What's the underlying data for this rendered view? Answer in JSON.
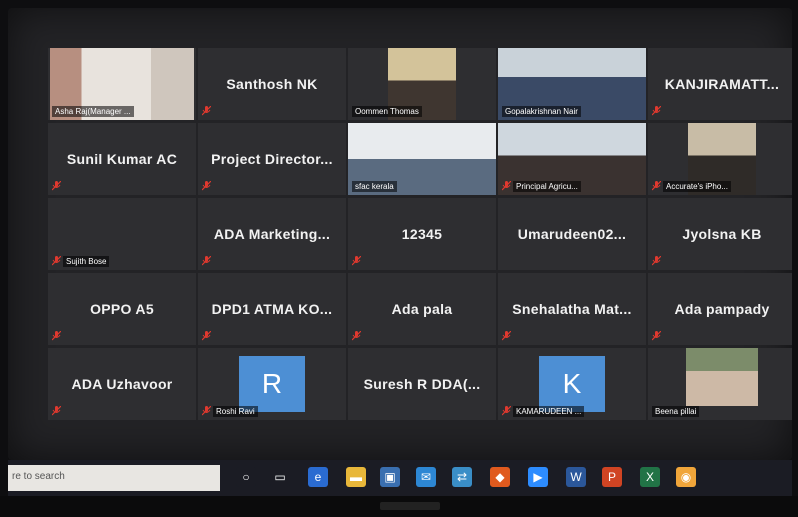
{
  "participants": [
    {
      "type": "video",
      "label": "Asha Raj(Manager ...",
      "muted": false
    },
    {
      "type": "name",
      "name": "Santhosh NK",
      "muted": true
    },
    {
      "type": "video",
      "label": "Oommen Thomas",
      "muted": false
    },
    {
      "type": "video",
      "label": "Gopalakrishnan Nair",
      "muted": false,
      "active": true
    },
    {
      "type": "name",
      "name": "KANJIRAMATT...",
      "muted": true
    },
    {
      "type": "name",
      "name": "Sunil Kumar AC",
      "muted": true
    },
    {
      "type": "name",
      "name": "Project Director...",
      "muted": true
    },
    {
      "type": "video",
      "label": "sfac kerala",
      "muted": false
    },
    {
      "type": "video",
      "label": "Principal Agricu...",
      "muted": true
    },
    {
      "type": "video",
      "label": "Accurate's iPho...",
      "muted": true
    },
    {
      "type": "label-only",
      "label": "Sujith Bose",
      "muted": true
    },
    {
      "type": "name",
      "name": "ADA Marketing...",
      "muted": true
    },
    {
      "type": "name",
      "name": "12345",
      "muted": true
    },
    {
      "type": "name",
      "name": "Umarudeen02...",
      "muted": false
    },
    {
      "type": "name",
      "name": "Jyolsna KB",
      "muted": true
    },
    {
      "type": "name",
      "name": "OPPO A5",
      "muted": true
    },
    {
      "type": "name",
      "name": "DPD1 ATMA KO...",
      "muted": true
    },
    {
      "type": "name",
      "name": "Ada pala",
      "muted": true
    },
    {
      "type": "name",
      "name": "Snehalatha Mat...",
      "muted": true
    },
    {
      "type": "name",
      "name": "Ada pampady",
      "muted": true
    },
    {
      "type": "name",
      "name": "ADA Uzhavoor",
      "muted": true
    },
    {
      "type": "avatar",
      "letter": "R",
      "label": "Roshi Ravi",
      "muted": true
    },
    {
      "type": "name",
      "name": "Suresh R DDA(...",
      "muted": false
    },
    {
      "type": "avatar",
      "letter": "K",
      "label": "KAMARUDEEN ...",
      "muted": true
    },
    {
      "type": "video",
      "label": "Beena pillai",
      "muted": false
    }
  ],
  "taskbar": {
    "search_placeholder": "re to search",
    "icons": [
      "cortana-icon",
      "task-view-icon",
      "edge-icon",
      "file-explorer-icon",
      "store-icon",
      "mail-icon",
      "network-app-icon",
      "office-icon",
      "zoom-icon",
      "word-icon",
      "powerpoint-icon",
      "excel-icon",
      "chrome-icon"
    ]
  },
  "colors": {
    "mute": "#e0392f",
    "active_border": "#d6d43a",
    "tile": "#2e2e31",
    "avatar": "#4d8fd4"
  }
}
